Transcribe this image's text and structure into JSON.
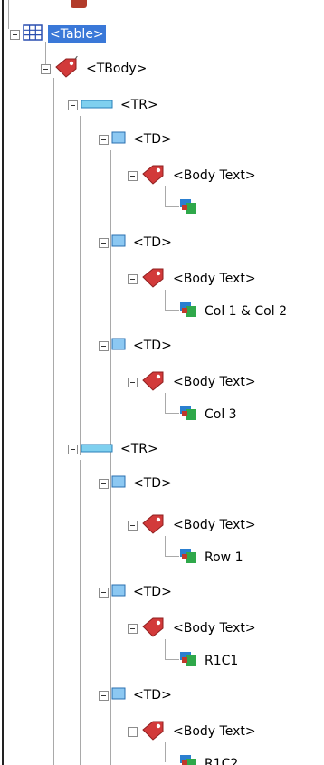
{
  "tree": {
    "nodes": [
      {
        "id": "table",
        "label": "<Table>",
        "icon": "table-grid-icon",
        "selected": true
      },
      {
        "id": "tbody",
        "label": "<TBody>",
        "icon": "tag-icon"
      },
      {
        "id": "tr1",
        "label": "<TR>",
        "icon": "row-icon"
      },
      {
        "id": "td1",
        "label": "<TD>",
        "icon": "cell-icon"
      },
      {
        "id": "bt1",
        "label": "<Body Text>",
        "icon": "tag-icon"
      },
      {
        "id": "c1",
        "label": "",
        "icon": "content-icon"
      },
      {
        "id": "td2",
        "label": "<TD>",
        "icon": "cell-icon"
      },
      {
        "id": "bt2",
        "label": "<Body Text>",
        "icon": "tag-icon"
      },
      {
        "id": "c2",
        "label": "Col 1 & Col 2",
        "icon": "content-icon"
      },
      {
        "id": "td3",
        "label": "<TD>",
        "icon": "cell-icon"
      },
      {
        "id": "bt3",
        "label": "<Body Text>",
        "icon": "tag-icon"
      },
      {
        "id": "c3",
        "label": "Col 3",
        "icon": "content-icon"
      },
      {
        "id": "tr2",
        "label": "<TR>",
        "icon": "row-icon"
      },
      {
        "id": "td4",
        "label": "<TD>",
        "icon": "cell-icon"
      },
      {
        "id": "bt4",
        "label": "<Body Text>",
        "icon": "tag-icon"
      },
      {
        "id": "c4",
        "label": "Row 1",
        "icon": "content-icon"
      },
      {
        "id": "td5",
        "label": "<TD>",
        "icon": "cell-icon"
      },
      {
        "id": "bt5",
        "label": "<Body Text>",
        "icon": "tag-icon"
      },
      {
        "id": "c5",
        "label": "R1C1",
        "icon": "content-icon"
      },
      {
        "id": "td6",
        "label": "<TD>",
        "icon": "cell-icon"
      },
      {
        "id": "bt6",
        "label": "<Body Text>",
        "icon": "tag-icon"
      },
      {
        "id": "c6",
        "label": "R1C2",
        "icon": "content-icon"
      }
    ],
    "colors": {
      "selection": "#3a78d8",
      "tag_red": "#d23a3a",
      "row_cyan": "#7fd0ef",
      "cell_blue": "#5aa0e0",
      "content_green": "#2fa84a",
      "content_red": "#c0392b",
      "connector": "#a9a9a9"
    }
  }
}
